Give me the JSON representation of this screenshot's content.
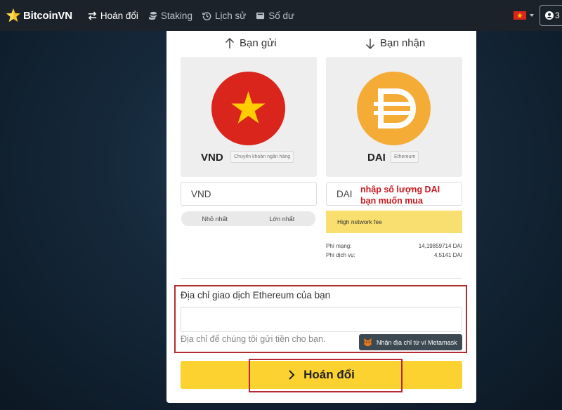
{
  "nav": {
    "brand": "BitcoinVN",
    "items": [
      {
        "label": "Hoán đổi",
        "icon": "swap-icon"
      },
      {
        "label": "Staking",
        "icon": "coins-icon"
      },
      {
        "label": "Lịch sử",
        "icon": "history-icon"
      },
      {
        "label": "Số dư",
        "icon": "wallet-icon"
      }
    ],
    "account_label": "3"
  },
  "send": {
    "title": "Bạn gửi",
    "currency": "VND",
    "method": "Chuyển khoản ngân hàng",
    "amount_placeholder": "VND",
    "min_label": "Nhỏ nhất",
    "max_label": "Lớn nhất",
    "flag_color": "#da251d"
  },
  "receive": {
    "title": "Bạn nhận",
    "currency": "DAI",
    "network": "Ethereum",
    "amount_placeholder": "DAI",
    "warning": "High network fee",
    "network_fee_label": "Phí mạng:",
    "network_fee_value": "14,19859714 DAI",
    "service_fee_label": "Phí dịch vụ:",
    "service_fee_value": "4,5141 DAI",
    "coin_color": "#f5ac37"
  },
  "address": {
    "label": "Địa chỉ giao dịch Ethereum của bạn",
    "help": "Địa chỉ để chúng tôi gửi tiền cho bạn.",
    "metamask_label": "Nhận địa chỉ từ ví Metamask"
  },
  "submit_label": "Hoán đổi",
  "annotation": {
    "line1": "nhập số lượng DAI",
    "line2": "bạn muốn mua",
    "color": "#c8191f"
  },
  "colors": {
    "accent": "#fbd230",
    "warning": "#f8df6f",
    "navbar": "#1b2229"
  }
}
